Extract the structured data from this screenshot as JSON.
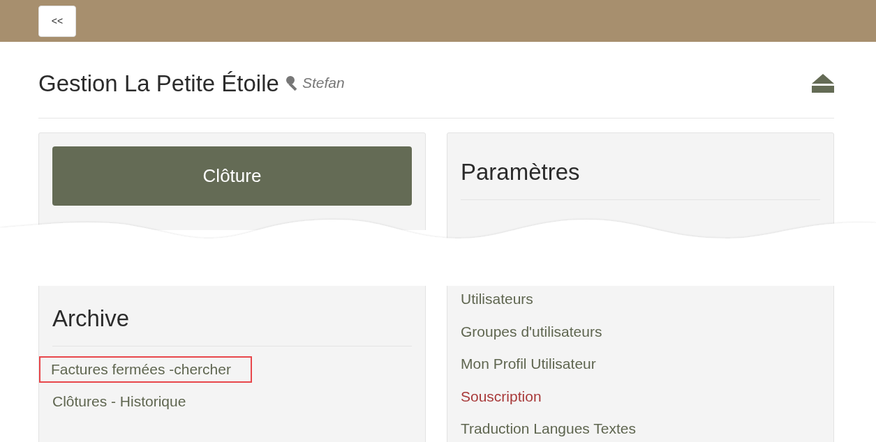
{
  "top_bar": {
    "back_button": "<<"
  },
  "header": {
    "title": "Gestion La Petite Étoile",
    "user": "Stefan"
  },
  "close_card": {
    "button": "Clôture"
  },
  "archive": {
    "title": "Archive",
    "links": [
      {
        "label": "Factures fermées -chercher",
        "highlighted": true
      },
      {
        "label": "Clôtures - Historique",
        "highlighted": false
      }
    ]
  },
  "settings": {
    "title": "Paramètres",
    "links": [
      {
        "label": "Utilisateurs",
        "color": "#5f6650"
      },
      {
        "label": "Groupes d'utilisateurs",
        "color": "#5f6650"
      },
      {
        "label": "Mon Profil Utilisateur",
        "color": "#5f6650"
      },
      {
        "label": "Souscription",
        "color": "#a83a3a"
      },
      {
        "label": "Traduction Langues Textes",
        "color": "#5f6650"
      }
    ]
  }
}
